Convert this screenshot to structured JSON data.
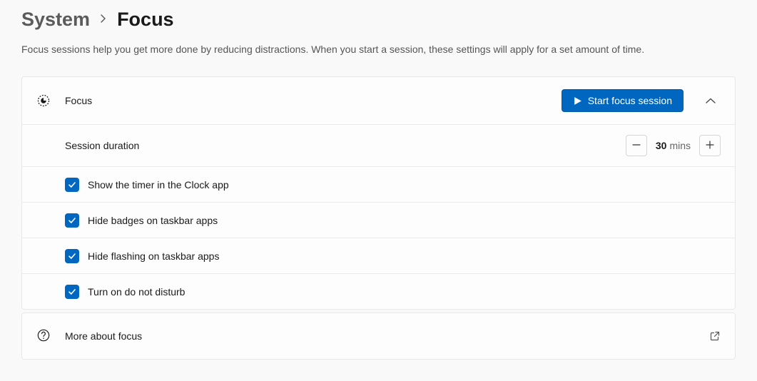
{
  "breadcrumb": {
    "parent": "System",
    "current": "Focus"
  },
  "subtitle": "Focus sessions help you get more done by reducing distractions. When you start a session, these settings will apply for a set amount of time.",
  "focus_panel": {
    "title": "Focus",
    "start_button": "Start focus session",
    "session_duration_label": "Session duration",
    "session_duration_value": "30",
    "session_duration_unit": "mins",
    "options": [
      "Show the timer in the Clock app",
      "Hide badges on taskbar apps",
      "Hide flashing on taskbar apps",
      "Turn on do not disturb"
    ]
  },
  "more_link": {
    "label": "More about focus"
  }
}
